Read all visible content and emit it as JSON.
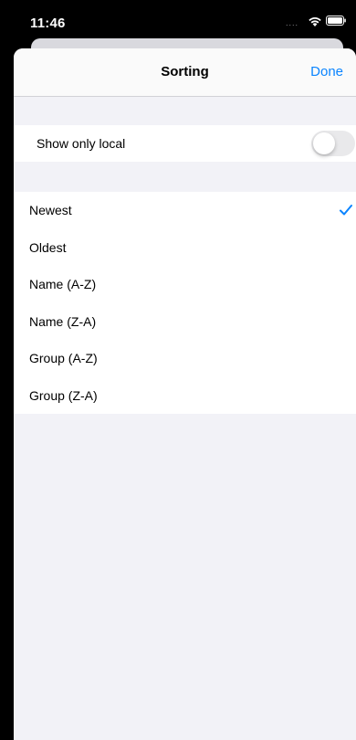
{
  "status_bar": {
    "time": "11:46",
    "signal": "....",
    "wifi_icon": "wifi-icon",
    "battery_icon": "battery-icon"
  },
  "nav": {
    "title": "Sorting",
    "done_label": "Done"
  },
  "filter": {
    "label": "Show only local",
    "enabled": false
  },
  "sort_options": [
    {
      "label": "Newest",
      "selected": true
    },
    {
      "label": "Oldest",
      "selected": false
    },
    {
      "label": "Name (A-Z)",
      "selected": false
    },
    {
      "label": "Name (Z-A)",
      "selected": false
    },
    {
      "label": "Group (A-Z)",
      "selected": false
    },
    {
      "label": "Group (Z-A)",
      "selected": false
    }
  ],
  "colors": {
    "accent": "#0a84ff",
    "grouped_background": "#f2f2f7",
    "row_background": "#ffffff",
    "switch_off": "#e9e9eb"
  }
}
